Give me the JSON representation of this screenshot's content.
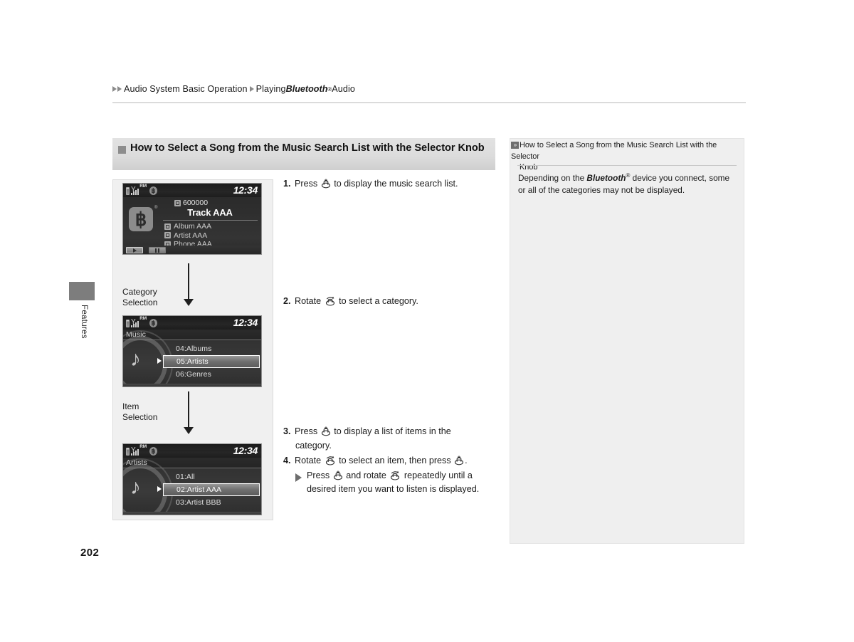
{
  "breadcrumb": {
    "part1": "Audio System Basic Operation",
    "part2_pre": "Playing ",
    "part2_italic": "Bluetooth",
    "part2_sup": "®",
    "part2_post": " Audio"
  },
  "side_tab": {
    "label": "Features"
  },
  "page": {
    "number": "202"
  },
  "section": {
    "title": "How to Select a Song from the Music Search List with the Selector Knob"
  },
  "figure": {
    "flow_labels": [
      "Category\nSelection",
      "Item\nSelection"
    ],
    "screen1": {
      "clock": "12:34",
      "status_icons": [
        "battery-icon",
        "signal-roaming-icon",
        "bluetooth-icon"
      ],
      "track_number": "600000",
      "track_title": "Track AAA",
      "meta": [
        {
          "icon": "album-icon",
          "text": "Album AAA"
        },
        {
          "icon": "artist-icon",
          "text": "Artist AAA"
        },
        {
          "icon": "phone-icon",
          "text": "Phone AAA"
        }
      ],
      "buttons": [
        "play-button",
        "pause-button"
      ]
    },
    "screen2": {
      "clock": "12:34",
      "subtitle": "Music",
      "rows": [
        "04:Albums",
        "05:Artists",
        "06:Genres"
      ],
      "selected_index": 1
    },
    "screen3": {
      "clock": "12:34",
      "subtitle": "Artists",
      "rows": [
        "01:All",
        "02:Artist AAA",
        "03:Artist BBB"
      ],
      "selected_index": 1
    }
  },
  "steps": {
    "s1": {
      "num": "1.",
      "a": "Press",
      "b": "to display the music search list."
    },
    "s2": {
      "num": "2.",
      "a": "Rotate",
      "b": "to select a category."
    },
    "s3": {
      "num": "3.",
      "a": "Press",
      "b": "to display a list of items in the",
      "c": "category."
    },
    "s4": {
      "num": "4.",
      "a": "Rotate",
      "b": "to select an item, then press",
      "c": ".",
      "sub_a": "Press",
      "sub_b": "and rotate",
      "sub_c": "repeatedly until a",
      "sub_d": "desired item you want to listen is",
      "sub_e": "displayed."
    }
  },
  "info": {
    "title_line1": "How to Select a Song from the Music Search List with the Selector",
    "title_line2": "Knob",
    "body_pre": "Depending on the ",
    "body_italic": "Bluetooth",
    "body_sup": "®",
    "body_post": " device you connect, some or all of the categories may not be displayed."
  },
  "colors": {
    "panel_bg": "#f0f0f0",
    "info_bg": "#efefef",
    "title_bar": "#dcdcdc",
    "screen_bg": "#2f2f2f",
    "accent_gray": "#8d8d8d"
  }
}
